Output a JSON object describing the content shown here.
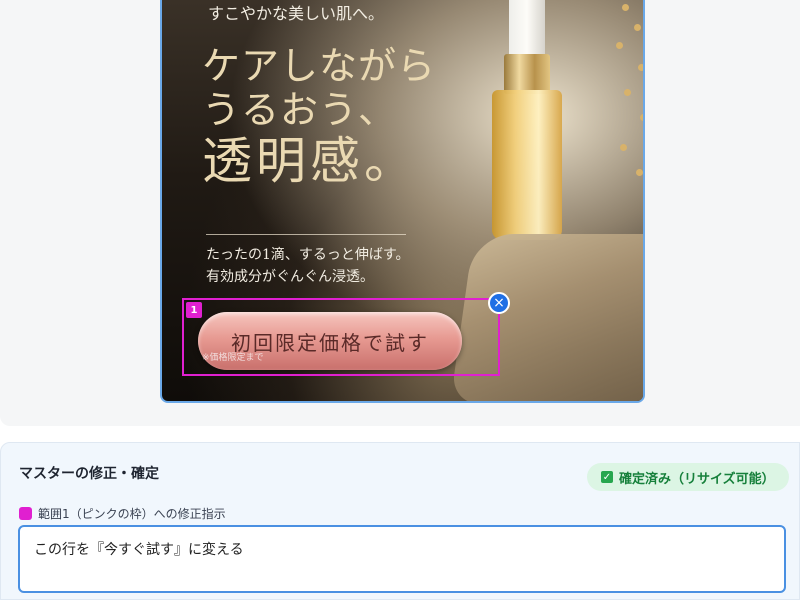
{
  "ad": {
    "tagline": "すこやかな美しい肌へ。",
    "headline": [
      "ケアしながら",
      "うるおう、",
      "透明感。"
    ],
    "body": [
      "たったの1滴、するっと伸ばす。",
      "有効成分がぐんぐん浸透。"
    ],
    "cta_label": "初回限定価格で試す",
    "cta_note": "※価格限定まで"
  },
  "selection": {
    "tag": "1",
    "close_glyph": "×",
    "color": "#e020d0"
  },
  "master": {
    "title": "マスターの修正・確定",
    "status_badge": "確定済み（リサイズ可能）",
    "instruction_label": "範囲1（ピンクの枠）への修正指示",
    "instruction_value": "この行を『今すぐ試す』に変える"
  },
  "colors": {
    "accent": "#4a90e2",
    "selection": "#e020d0",
    "confirmed": "#16803b"
  }
}
